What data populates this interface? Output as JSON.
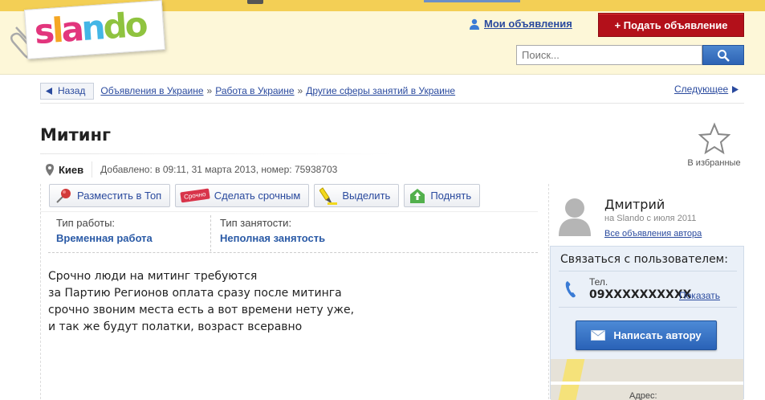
{
  "header": {
    "logo": "slando",
    "my_ads": "Мои объявления",
    "post_ad": "+ Подать объявление",
    "search_placeholder": "Поиск..."
  },
  "breadcrumb": {
    "back": "Назад",
    "items": [
      "Объявления в Украине",
      "Работа в Украине",
      "Другие сферы занятий в Украине"
    ],
    "next": "Следующее"
  },
  "ad": {
    "title": "Митинг",
    "favorite": "В избранные",
    "city": "Киев",
    "added": "Добавлено: в 09:11, 31 марта 2013, номер: 75938703",
    "actions": [
      "Разместить в Топ",
      "Сделать срочным",
      "Выделить",
      "Поднять"
    ],
    "urgent_tag": "Срочно",
    "attributes": [
      {
        "label": "Тип работы:",
        "value": "Временная работа"
      },
      {
        "label": "Тип занятости:",
        "value": "Неполная занятость"
      }
    ],
    "description": [
      "Срочно люди на митинг требуются",
      "за Партию Регионов оплата сразу после митинга",
      "срочно звоним места есть а вот времени нету уже,",
      "и так же будут полатки, возраст всеравно"
    ]
  },
  "user": {
    "name": "Дмитрий",
    "since": "на Slando с июля 2011",
    "all_ads": "Все объявления автора",
    "contact_title": "Связаться с пользователем:",
    "phone_label": "Тел.",
    "phone": "09XXXXXXXXXX",
    "show": "Показать",
    "write": "Написать автору",
    "map_label": "Адрес:"
  },
  "colors": {
    "header_bg": "#fdf7d8",
    "topbar": "#f3cf55",
    "post_button": "#b3101a",
    "link": "#2a4a9e",
    "primary_button": "#2a62b7"
  }
}
